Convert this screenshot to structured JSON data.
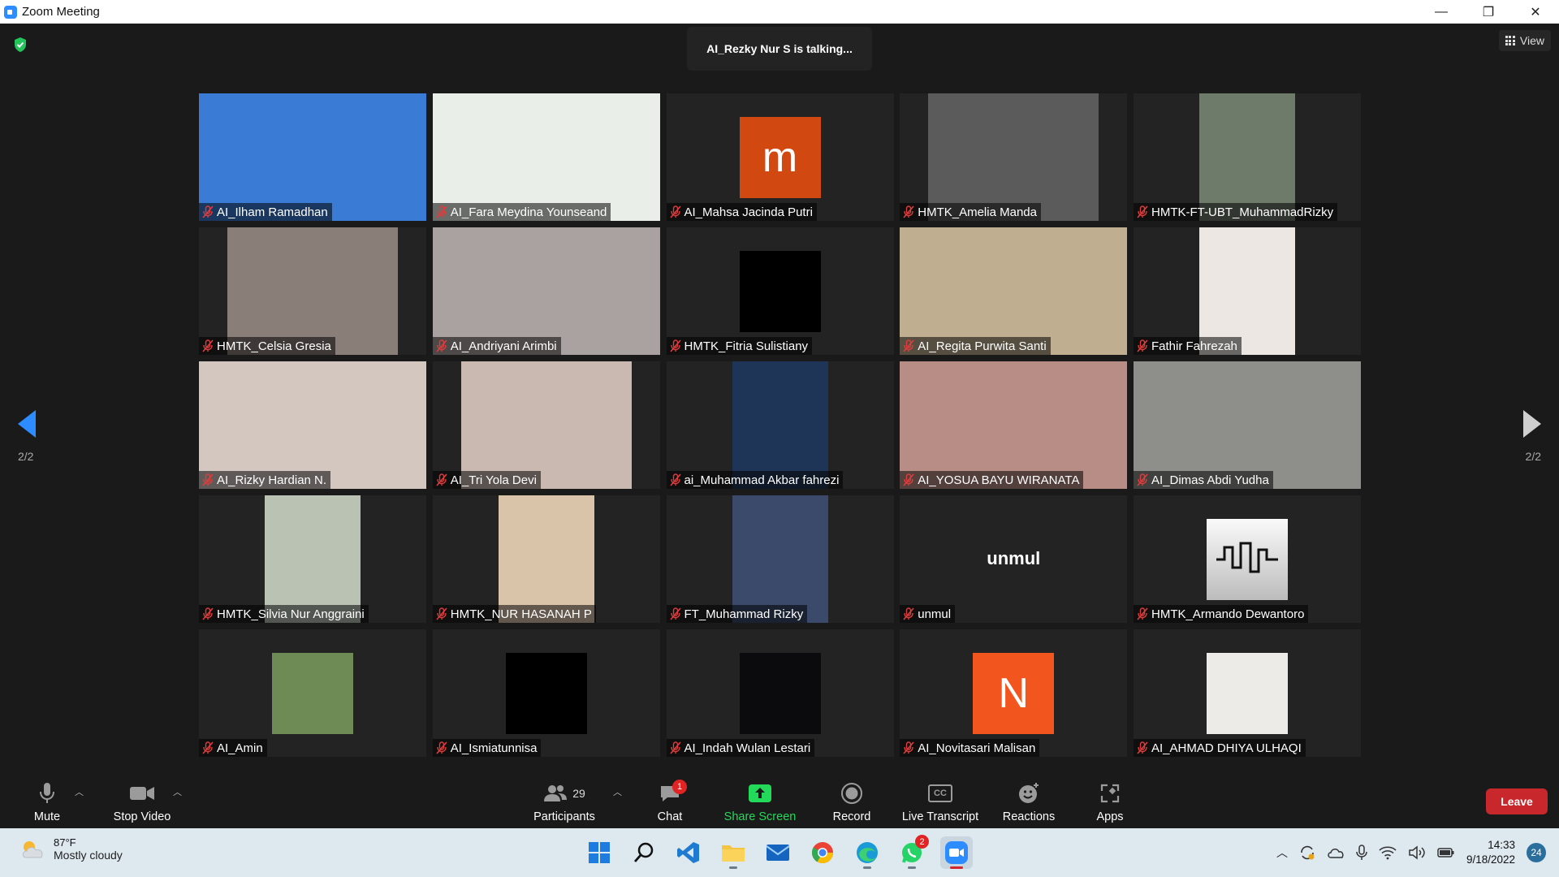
{
  "window": {
    "title": "Zoom Meeting",
    "minimize": "—",
    "restore": "❐",
    "close": "✕"
  },
  "meeting": {
    "talking": "AI_Rezky Nur S is talking...",
    "view_label": "View",
    "page_indicator": "2/2"
  },
  "participants": [
    {
      "name": "AI_Ilham Ramadhan",
      "bg": "#3a7bd5"
    },
    {
      "name": "AI_Fara Meydina Younseand",
      "bg": "#e9efe8"
    },
    {
      "name": "AI_Mahsa Jacinda Putri",
      "avatar": "m",
      "avatar_color": "#d14810"
    },
    {
      "name": "HMTK_Amelia Manda",
      "bg": "#5b5b5b"
    },
    {
      "name": "HMTK-FT-UBT_MuhammadRizky",
      "bg": "#6e7a6a"
    },
    {
      "name": "HMTK_Celsia Gresia",
      "bg": "#8a7f78"
    },
    {
      "name": "AI_Andriyani Arimbi",
      "bg": "#a9a2a0"
    },
    {
      "name": "HMTK_Fitria Sulistiany",
      "bg": "#000000"
    },
    {
      "name": "AI_Regita Purwita Santi",
      "bg": "#bfae8f"
    },
    {
      "name": "Fathir Fahrezah",
      "bg": "#ece7e2"
    },
    {
      "name": "AI_Rizky Hardian N.",
      "bg": "#d3c7c0"
    },
    {
      "name": "AI_Tri Yola Devi",
      "bg": "#c9b9b1"
    },
    {
      "name": "ai_Muhammad Akbar fahrezi",
      "bg": "#1f3558"
    },
    {
      "name": "AI_YOSUA BAYU WIRANATA",
      "bg": "#b88d86"
    },
    {
      "name": "AI_Dimas Abdi Yudha",
      "bg": "#8e8e8a"
    },
    {
      "name": "HMTK_Silvia Nur Anggraini",
      "bg": "#b9c2b3"
    },
    {
      "name": "HMTK_NUR HASANAH P",
      "bg": "#d9c4aa"
    },
    {
      "name": "FT_Muhammad Rizky",
      "bg": "#3b4a6b"
    },
    {
      "name": "unmul",
      "text_avatar": "unmul"
    },
    {
      "name": "HMTK_Armando Dewantoro",
      "logo": true
    },
    {
      "name": "AI_Amin",
      "bg": "#6e8a55"
    },
    {
      "name": "AI_Ismiatunnisa",
      "bg": "#000000"
    },
    {
      "name": "AI_Indah Wulan Lestari",
      "bg": "#0b0a0c"
    },
    {
      "name": "AI_Novitasari Malisan",
      "avatar": "N",
      "avatar_color": "#f2551d"
    },
    {
      "name": "AI_AHMAD DHIYA ULHAQI",
      "bg": "#ecebe8"
    }
  ],
  "toolbar": {
    "mute": "Mute",
    "stop_video": "Stop Video",
    "participants": "Participants",
    "participant_count": "29",
    "chat": "Chat",
    "chat_badge": "1",
    "share_screen": "Share Screen",
    "record": "Record",
    "live_transcript": "Live Transcript",
    "cc": "CC",
    "reactions": "Reactions",
    "apps": "Apps",
    "leave": "Leave"
  },
  "taskbar": {
    "temperature": "87°F",
    "weather": "Mostly cloudy",
    "whatsapp_badge": "2",
    "time": "14:33",
    "date": "9/18/2022",
    "notifications": "24"
  },
  "colors": {
    "accent": "#2d8cff",
    "share_green": "#23d959",
    "leave_red": "#c8272c",
    "muted_red": "#e03c3c"
  }
}
